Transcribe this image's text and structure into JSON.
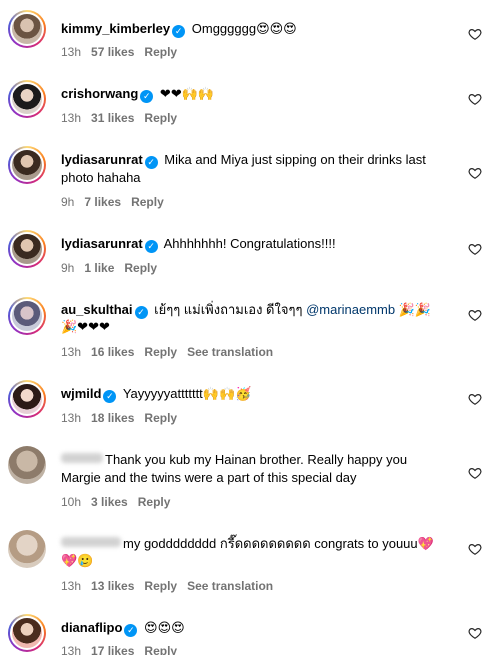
{
  "comments": [
    {
      "user": "kimmy_kimberley",
      "text": "Omgggggg",
      "emoji": "😍😍😍",
      "time": "13h",
      "likes": "57 likes",
      "reply": "Reply"
    },
    {
      "user": "crishorwang",
      "text": "",
      "emoji": "❤❤🙌🙌",
      "time": "13h",
      "likes": "31 likes",
      "reply": "Reply"
    },
    {
      "user": "lydiasarunrat",
      "text": "Mika and Miya just sipping on their drinks last",
      "text2": "photo hahaha",
      "time": "9h",
      "likes": "7 likes",
      "reply": "Reply"
    },
    {
      "user": "lydiasarunrat",
      "text": "Ahhhhhhh! Congratulations!!!!",
      "time": "9h",
      "likes": "1 like",
      "reply": "Reply"
    },
    {
      "user": "au_skulthai",
      "text": "เย้ๆๆ แม่เพิ่งถามเอง ดีใจๆๆ",
      "mention": "@marinaemmb",
      "emoji": "🎉🎉",
      "emoji2": "🎉❤❤❤",
      "time": "13h",
      "likes": "16 likes",
      "reply": "Reply",
      "translate": "See translation"
    },
    {
      "user": "wjmild",
      "text": "Yayyyyyattttttt",
      "emoji": "🙌🙌🥳",
      "time": "13h",
      "likes": "18 likes",
      "reply": "Reply"
    },
    {
      "user": "",
      "text": "Thank you kub my Hainan brother. Really happy you",
      "text2": "Margie and the twins were a part of this special day",
      "time": "10h",
      "likes": "3 likes",
      "reply": "Reply"
    },
    {
      "user": "",
      "text": "my godddddddd กรี๊ดดดดดดดดด congrats to youuu",
      "emoji": "💖",
      "emoji2": "💖🥲",
      "time": "13h",
      "likes": "13 likes",
      "reply": "Reply",
      "translate": "See translation"
    },
    {
      "user": "dianaflipo",
      "text": "",
      "emoji": "😍😍😍",
      "time": "13h",
      "likes": "17 likes",
      "reply": "Reply"
    }
  ],
  "icons": {
    "verified": "verified-badge-icon",
    "like": "heart-outline-icon"
  },
  "colors": {
    "verified": "#0095f6",
    "meta": "#737373",
    "mention": "#00376b"
  }
}
